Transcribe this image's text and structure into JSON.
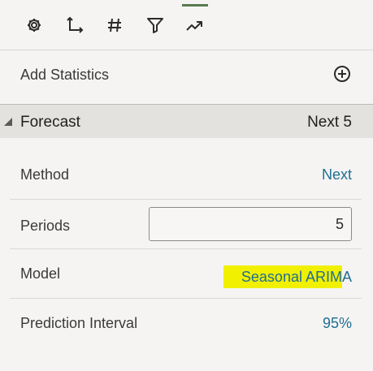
{
  "toolbar": {
    "tools": [
      {
        "icon": "gear-icon"
      },
      {
        "icon": "axes-icon"
      },
      {
        "icon": "hash-icon"
      },
      {
        "icon": "filter-icon"
      },
      {
        "icon": "trend-icon",
        "active": true
      }
    ],
    "active_color": "#5a7a4f"
  },
  "add_statistics": {
    "label": "Add Statistics",
    "icon": "add-circle-icon"
  },
  "forecast": {
    "title": "Forecast",
    "value": "Next 5",
    "method": {
      "label": "Method",
      "value": "Next"
    },
    "periods": {
      "label": "Periods",
      "value": "5"
    },
    "model": {
      "label": "Model",
      "value_part1": "Seasonal ARIM",
      "value_part2": "A"
    },
    "prediction_interval": {
      "label": "Prediction Interval",
      "value": "95%"
    }
  },
  "colors": {
    "link": "#1f6e94",
    "highlight": "#f0f000",
    "section_bg": "#e3e2df"
  }
}
